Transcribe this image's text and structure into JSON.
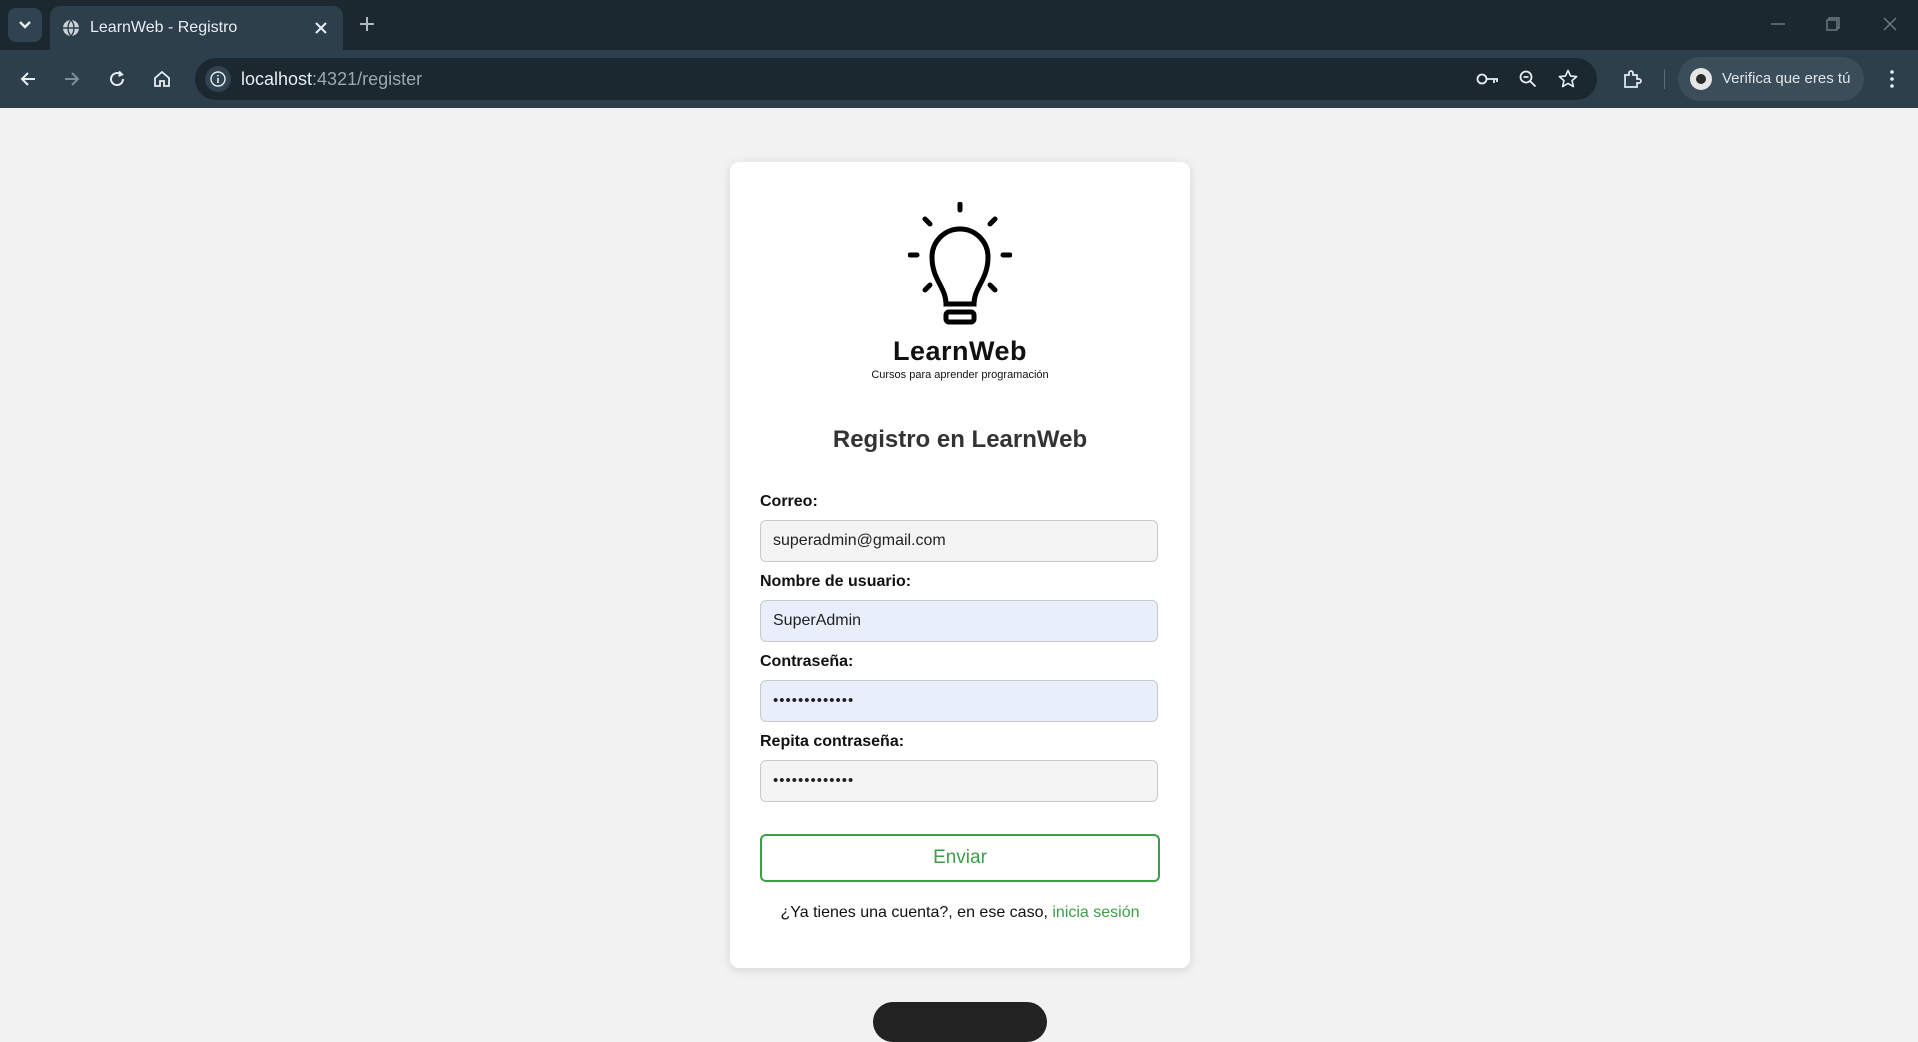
{
  "browser": {
    "tab_title": "LearnWeb - Registro",
    "url_host": "localhost",
    "url_path": ":4321/register",
    "profile_label": "Verifica que eres tú"
  },
  "brand": {
    "name": "LearnWeb",
    "tagline": "Cursos para aprender programación"
  },
  "form": {
    "heading": "Registro en LearnWeb",
    "email_label": "Correo:",
    "email_value": "superadmin@gmail.com",
    "username_label": "Nombre de usuario:",
    "username_value": "SuperAdmin",
    "password_label": "Contraseña:",
    "password_value": "•••••••••••••",
    "repeat_label": "Repita contraseña:",
    "repeat_value": "•••••••••••••",
    "submit_label": "Enviar",
    "login_prompt": "¿Ya tienes una cuenta?, en ese caso, ",
    "login_link": "inicia sesión"
  },
  "colors": {
    "accent": "#3e9e45",
    "chrome_dark": "#1b2830",
    "chrome": "#2c3f4b",
    "page_bg": "#f2f2f2",
    "autofill_bg": "#e8eefc"
  },
  "icons": [
    "tab-search-icon",
    "globe-icon",
    "close-icon",
    "plus-icon",
    "minimize-icon",
    "restore-icon",
    "window-close-icon",
    "back-arrow-icon",
    "forward-arrow-icon",
    "reload-icon",
    "home-icon",
    "site-info-icon",
    "key-icon",
    "zoom-icon",
    "star-icon",
    "extensions-icon",
    "kebab-menu-icon",
    "lightbulb-icon"
  ]
}
